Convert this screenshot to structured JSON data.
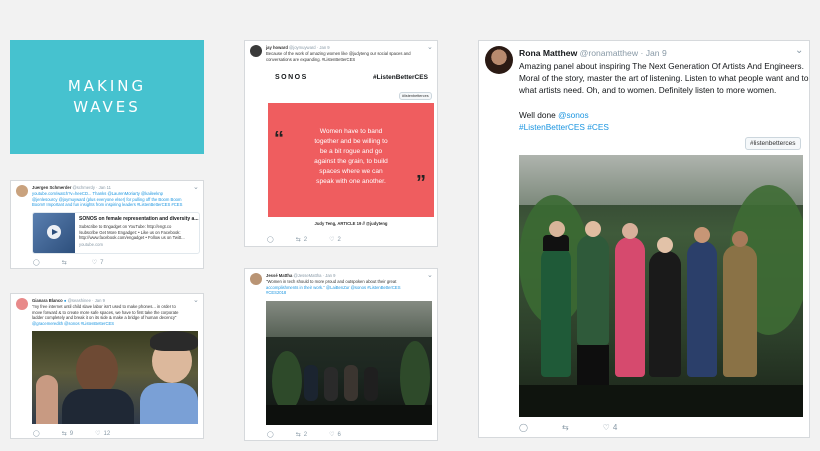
{
  "logo": {
    "line1": "MAKING",
    "line2": "WAVES"
  },
  "tweet_juergen": {
    "name": "Juergen Schmerder",
    "handle": "@schmerdy",
    "date": "Jan 11",
    "text_lines": [
      "youtube.com/watch?v=heeCD...  Thanks @LaurenMoriarty @kaileeknp",
      "@jenlesourcy @joymuyward (plus everyone else!) for pulling off the Boom Boom",
      "Boom!! Important and fun insights from inspiring leaders #ListenBetterCES #CES"
    ],
    "video_title": "SONOS on female representation and diversity a...",
    "video_lines": [
      "Subscribe to Engadget on YouTube: http://engt.co",
      "/subscribe Get More Engadget: • Like us on Facebook:",
      "http://www.facebook.com/engadget • Follow us on Twitt..."
    ],
    "video_source": "youtube.com",
    "retweets": "",
    "likes": "7"
  },
  "tweet_gianna": {
    "name": "Gianara Blanco",
    "handle": "@seashinee",
    "date": "Jan 9",
    "text_lines": [
      "\"my free internet until child slave labor isn't used to make phones... in order to",
      "move forward & to create more safe spaces, we have to first take the corporate",
      "ladder completely and break it on its side & make a bridge of human decency\"",
      "@gracemeredith @sonos #ListenBetterCES"
    ],
    "replies": "",
    "retweets": "9",
    "likes": "12"
  },
  "tweet_jay": {
    "name": "jay howard",
    "handle": "@joymuyward",
    "date": "Jan 9",
    "text_lines": [
      "Because of the work of amazing women like @judyteng our social spaces and",
      "conversations are expanding. #ListenBetterCES"
    ],
    "banner_brand": "SONOS",
    "banner_tag": "#ListenBetterCES",
    "pill": "#listenbetterces",
    "quote_open": "“",
    "quote_close": "”",
    "quote_lines": [
      "Women have to band",
      "together and be willing to",
      "be a bit rogue and go",
      "against the grain, to build",
      "spaces where we can",
      "speak with one another."
    ],
    "attribution": "Judy Teng, ARTICLE 19 // @judyteng",
    "retweets": "2",
    "likes": "2"
  },
  "tweet_jesse": {
    "name": "Jessé Mattha",
    "handle": "@JesseMattha",
    "date": "Jan 9",
    "text_lines": [
      "\"Women in tech should to more proud and outspoken about their great",
      "accomplishments in their work.\" @LaiBenZur @sonos #ListenBetterCES",
      "#CES2018"
    ],
    "retweets": "2",
    "likes": "6"
  },
  "tweet_rona": {
    "name": "Rona Matthew",
    "handle": "@ronamatthew",
    "date": "Jan 9",
    "lines": [
      "Amazing panel about inspiring The Next Generation Of Artists And Engineers.",
      "Moral of the story,  master the art of listening. Listen to  what people want and to",
      "what artists need. Oh, and to women. Definitely listen to more women."
    ],
    "done_prefix": "Well done ",
    "done_mention": "@sonos",
    "hashtag1": "#ListenBetterCES",
    "hashtag2": "#CES",
    "pill": "#listenbetterces",
    "likes": "4"
  },
  "colors": {
    "brand_teal": "#46c2cf",
    "quote_red": "#ef5d5f",
    "link_blue": "#1b95e0"
  }
}
